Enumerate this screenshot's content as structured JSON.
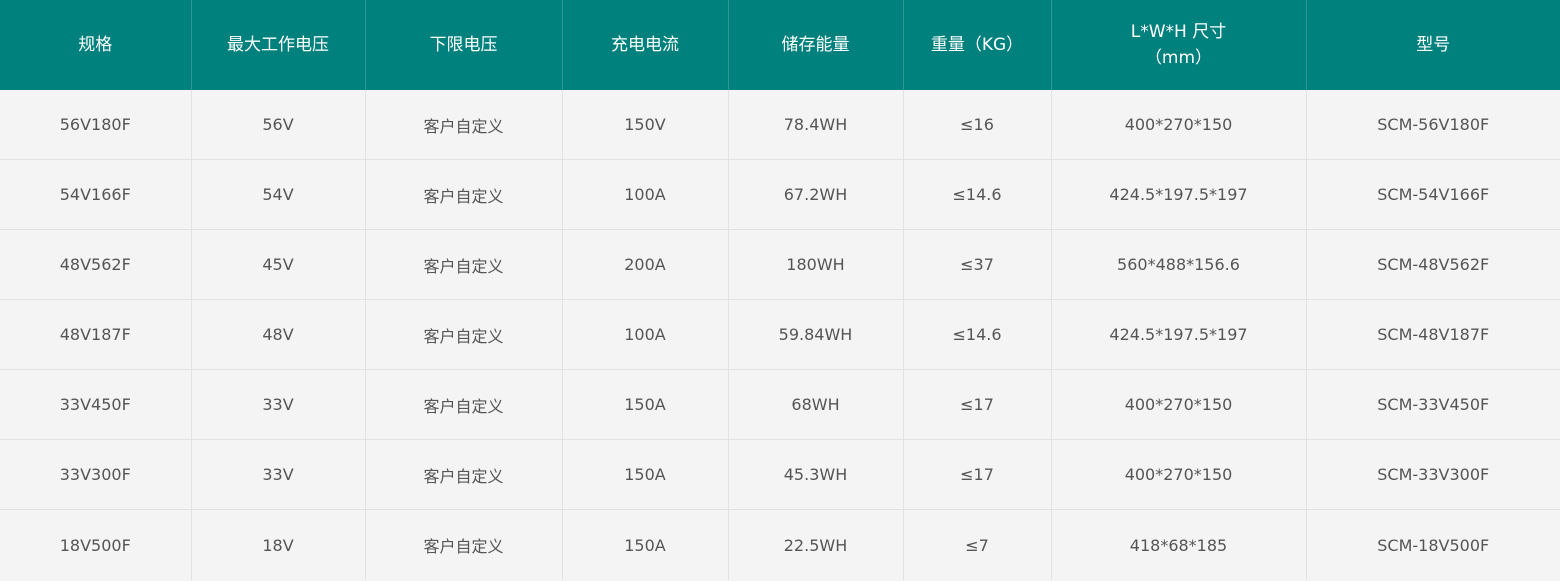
{
  "header": {
    "col1": "规格",
    "col2": "最大工作电压",
    "col3": "下限电压",
    "col4": "充电电流",
    "col5": "储存能量",
    "col6": "重量（KG）",
    "col7_line1": "L*W*H 尺寸",
    "col7_line2": "（mm）",
    "col8": "型号"
  },
  "rows": [
    [
      "56V180F",
      "56V",
      "客户自定义",
      "150V",
      "78.4WH",
      "≤16",
      "400*270*150",
      "SCM-56V180F"
    ],
    [
      "54V166F",
      "54V",
      "客户自定义",
      "100A",
      "67.2WH",
      "≤14.6",
      "424.5*197.5*197",
      "SCM-54V166F"
    ],
    [
      "48V562F",
      "45V",
      "客户自定义",
      "200A",
      "180WH",
      "≤37",
      "560*488*156.6",
      "SCM-48V562F"
    ],
    [
      "48V187F",
      "48V",
      "客户自定义",
      "100A",
      "59.84WH",
      "≤14.6",
      "424.5*197.5*197",
      "SCM-48V187F"
    ],
    [
      "33V450F",
      "33V",
      "客户自定义",
      "150A",
      "68WH",
      "≤17",
      "400*270*150",
      "SCM-33V450F"
    ],
    [
      "33V300F",
      "33V",
      "客户自定义",
      "150A",
      "45.3WH",
      "≤17",
      "400*270*150",
      "SCM-33V300F"
    ],
    [
      "18V500F",
      "18V",
      "客户自定义",
      "150A",
      "22.5WH",
      "≤7",
      "418*68*185",
      "SCM-18V500F"
    ]
  ],
  "colors": {
    "header_bg": "#00817d",
    "header_text": "#ffffff",
    "body_bg": "#f4f4f4",
    "body_text": "#555555"
  }
}
